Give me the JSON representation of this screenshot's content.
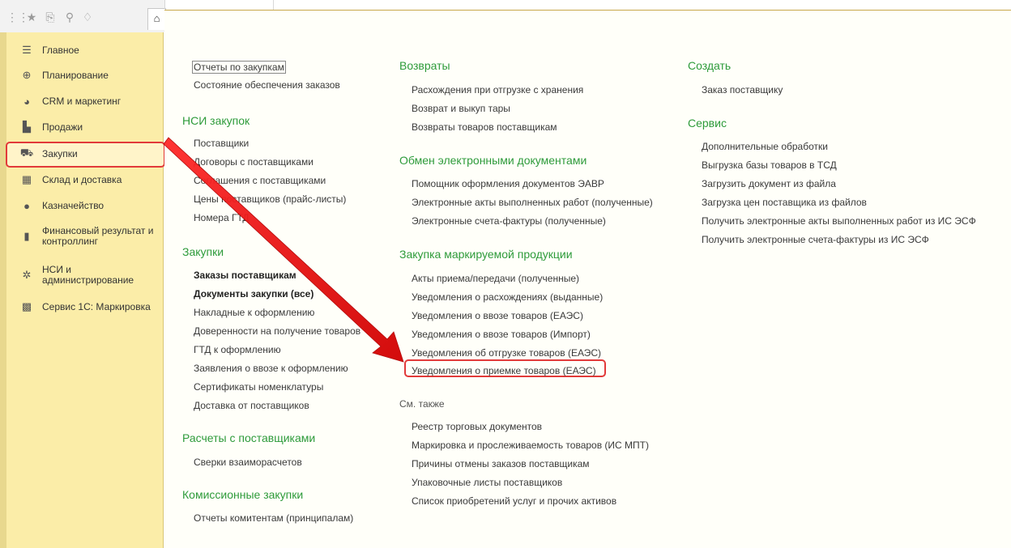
{
  "sidebar": {
    "items": [
      {
        "label": "Главное",
        "icon": "menu-lines-icon",
        "glyph": "☰"
      },
      {
        "label": "Планирование",
        "icon": "planning-icon",
        "glyph": "⊕"
      },
      {
        "label": "CRM и маркетинг",
        "icon": "crm-pie-icon",
        "glyph": "◕"
      },
      {
        "label": "Продажи",
        "icon": "shopping-bag-icon",
        "glyph": "▙"
      },
      {
        "label": "Закупки",
        "icon": "shopping-cart-icon",
        "glyph": "⛟"
      },
      {
        "label": "Склад и доставка",
        "icon": "warehouse-grid-icon",
        "glyph": "▦"
      },
      {
        "label": "Казначейство",
        "icon": "treasury-coin-icon",
        "glyph": "●"
      },
      {
        "label": "Финансовый результат и контроллинг",
        "icon": "bar-chart-icon",
        "glyph": "▮"
      },
      {
        "label": "НСИ и администрирование",
        "icon": "gear-icon",
        "glyph": "✲"
      },
      {
        "label": "Сервис 1С: Маркировка",
        "icon": "qr-code-icon",
        "glyph": "▩"
      }
    ]
  },
  "col1": {
    "top_links": [
      "Отчеты по закупкам",
      "Состояние обеспечения заказов"
    ],
    "nsi_heading": "НСИ закупок",
    "nsi_links": [
      "Поставщики",
      "Договоры с поставщиками",
      "Соглашения с поставщиками",
      "Цены поставщиков (прайс-листы)",
      "Номера ГТД"
    ],
    "zakupki_heading": "Закупки",
    "zakupki_bold": [
      "Заказы поставщикам",
      "Документы закупки (все)"
    ],
    "zakupki_links": [
      "Накладные к оформлению",
      "Доверенности на получение товаров",
      "ГТД к оформлению",
      "Заявления о ввозе к оформлению",
      "Сертификаты номенклатуры",
      "Доставка от поставщиков"
    ],
    "raschety_heading": "Расчеты с поставщиками",
    "raschety_links": [
      "Сверки взаиморасчетов"
    ],
    "komis_heading": "Комиссионные закупки",
    "komis_links": [
      "Отчеты комитентам (принципалам)"
    ]
  },
  "col2": {
    "vozvraty_heading": "Возвраты",
    "vozvraty_links": [
      "Расхождения при отгрузке с хранения",
      "Возврат и выкуп тары",
      "Возвраты товаров поставщикам"
    ],
    "obmen_heading": "Обмен электронными документами",
    "obmen_links": [
      "Помощник оформления документов ЭАВР",
      "Электронные акты выполненных работ (полученные)",
      "Электронные счета-фактуры (полученные)"
    ],
    "mark_heading": "Закупка маркируемой продукции",
    "mark_links": [
      "Акты приема/передачи (полученные)",
      "Уведомления о расхождениях (выданные)",
      "Уведомления о ввозе товаров (ЕАЭС)",
      "Уведомления о ввозе товаров (Импорт)",
      "Уведомления об отгрузке товаров (ЕАЭС)",
      "Уведомления о приемке товаров (ЕАЭС)"
    ],
    "see_also_heading": "См. также",
    "see_also_links": [
      "Реестр торговых документов",
      "Маркировка и прослеживаемость товаров (ИС МПТ)",
      "Причины отмены заказов поставщикам",
      "Упаковочные листы поставщиков",
      "Список приобретений услуг и прочих активов"
    ]
  },
  "col3": {
    "create_heading": "Создать",
    "create_links": [
      "Заказ поставщику"
    ],
    "service_heading": "Сервис",
    "service_links": [
      "Дополнительные обработки",
      "Выгрузка базы товаров в ТСД",
      "Загрузить документ из файла",
      "Загрузка цен поставщика из файлов",
      "Получить электронные акты выполненных работ из ИС ЭСФ",
      "Получить электронные счета-фактуры из ИС ЭСФ"
    ]
  },
  "colors": {
    "heading": "#2e9b3b",
    "sidebar_bg": "#fbeda8",
    "highlight": "#e23a3a"
  }
}
